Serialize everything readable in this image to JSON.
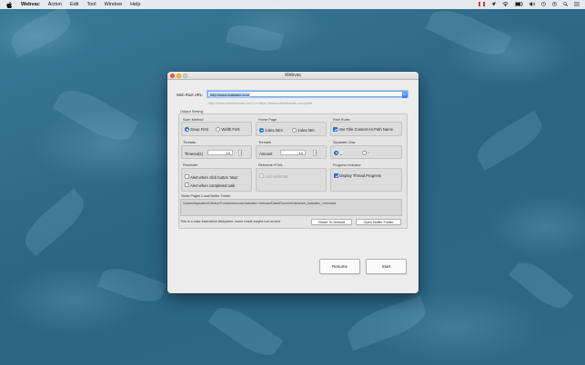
{
  "menubar": {
    "app_name": "Webvac",
    "items": [
      "Action",
      "Edit",
      "Tool",
      "Window",
      "Help"
    ]
  },
  "window": {
    "title": "Webvac"
  },
  "url": {
    "label": "Web Root URL:",
    "value": "http://www.kaisatec.com",
    "hint": "http://www.somedomain.com/ or https://www.somedomain.com/path"
  },
  "output": {
    "title": "Output Setting",
    "scan_method": {
      "title": "Scan Method",
      "options": [
        "Deep First",
        "Width First"
      ],
      "selected": "Deep First"
    },
    "home_page": {
      "title": "Home Page",
      "options": [
        "index.html",
        "index.htm"
      ],
      "selected": "index.html"
    },
    "path_rules": {
      "title": "Path Rules",
      "option": "Use Title Content As Path Name",
      "checked": true
    },
    "threads_timeout": {
      "title": "Threads",
      "label": "Timeout(s)",
      "value": "10"
    },
    "threads_amount": {
      "title": "Threads",
      "label": "Amount",
      "value": "10"
    },
    "separate_char": {
      "title": "Separate Char",
      "options": [
        "_",
        "-"
      ],
      "selected": "_"
    },
    "reminder": {
      "title": "Reminder",
      "options": [
        "Alert when click button 'stop'",
        "Alert when completed task"
      ]
    },
    "reformat": {
      "title": "Reformat HTML",
      "option": "Auto reformat"
    },
    "progress": {
      "title": "Progress Indicator",
      "option": "Display Thread Progress",
      "checked": true
    },
    "buffer": {
      "title": "Static Pages Local Buffer Folder",
      "path": "/Users/kaysatec/Library/Containers/com.kaisatec.webvac/Data/Documents/www_kaisatec_com/web"
    },
    "note": "This is a case insensitive filesystem, some result maybe not correct",
    "reset_button": "Reset To Default",
    "open_buffer_button": "Open Buffer Folder"
  },
  "actions": {
    "resume": "Resume",
    "start": "Start"
  }
}
